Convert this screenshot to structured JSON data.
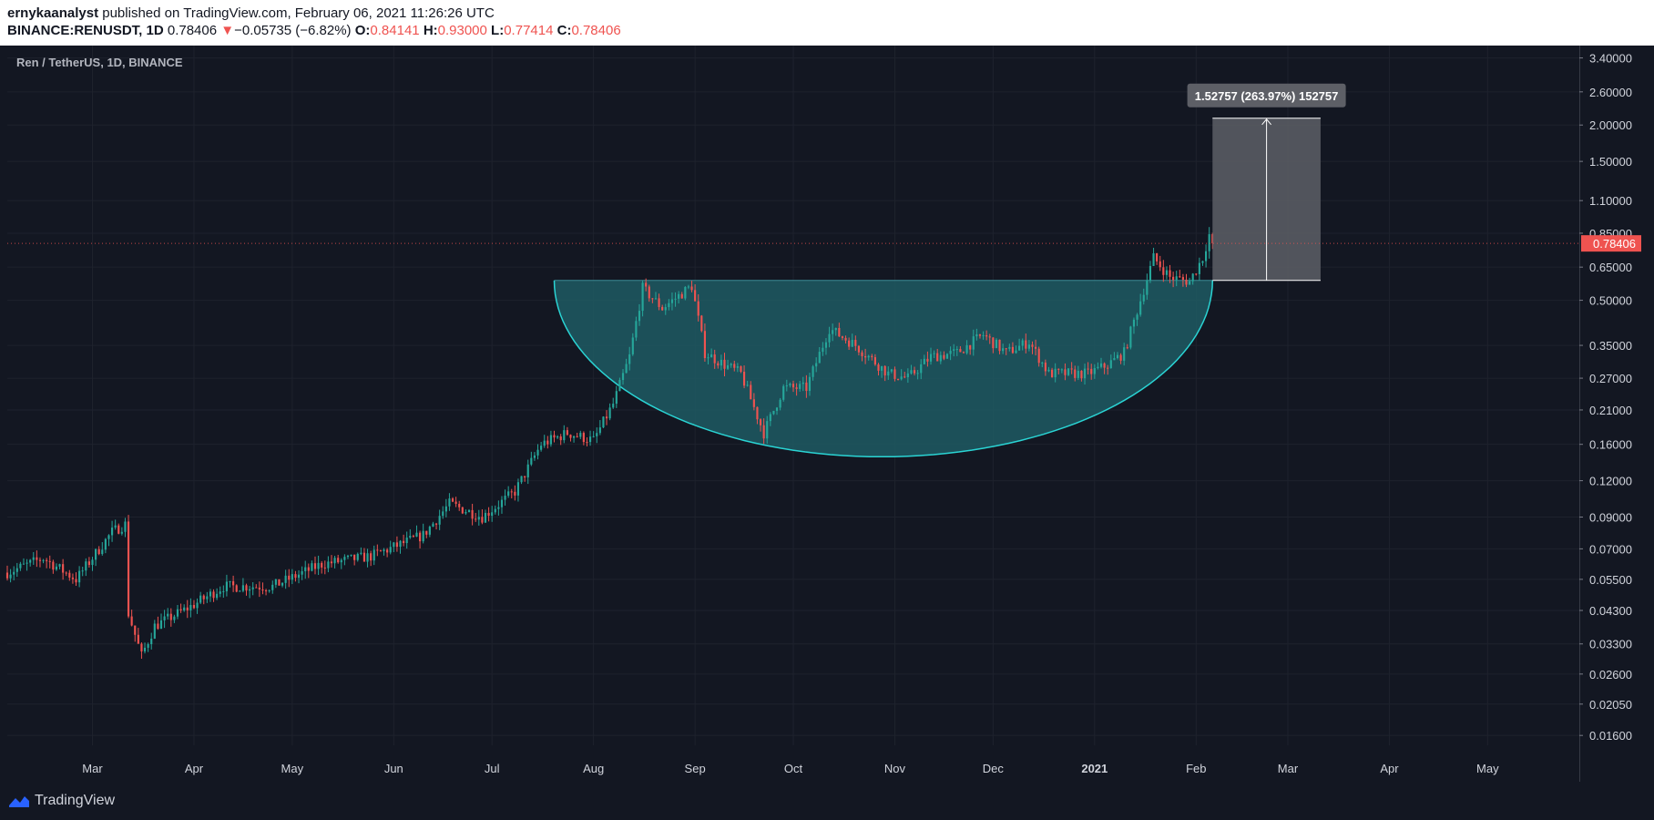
{
  "header": {
    "author": "ernykaanalyst",
    "published_text": "published on TradingView.com, February 06, 2021 11:26:26 UTC",
    "symbol": "BINANCE:RENUSDT, 1D",
    "price": "0.78406",
    "change_arrow": "▼",
    "change": "−0.05735 (−6.82%)",
    "o_label": "O:",
    "o_value": "0.84141",
    "h_label": "H:",
    "h_value": "0.93000",
    "l_label": "L:",
    "l_value": "0.77414",
    "c_label": "C:",
    "c_value": "0.78406"
  },
  "footer": {
    "brand": "TradingView",
    "brand_icon": "tradingview-logo-icon"
  },
  "colors": {
    "background": "#131722",
    "up": "#26a69a",
    "down": "#ef5350",
    "cup_fill": "#1e5a63",
    "cup_line": "#2ad4d4",
    "measure_fill": "#5d5f66",
    "grid": "#1e222d"
  },
  "chart_data": {
    "type": "candlestick",
    "title": "Ren / TetherUS, 1D, BINANCE",
    "scale": "log",
    "ylim": [
      0.0148,
      3.75
    ],
    "y_ticks": [
      "3.40000",
      "2.60000",
      "2.00000",
      "1.50000",
      "1.10000",
      "0.85000",
      "0.65000",
      "0.50000",
      "0.35000",
      "0.27000",
      "0.21000",
      "0.16000",
      "0.12000",
      "0.09000",
      "0.07000",
      "0.05500",
      "0.04300",
      "0.03300",
      "0.02600",
      "0.02050",
      "0.01600"
    ],
    "x_ticks": [
      {
        "label": "Mar",
        "date": "2020-03-01"
      },
      {
        "label": "Apr",
        "date": "2020-04-01"
      },
      {
        "label": "May",
        "date": "2020-05-01"
      },
      {
        "label": "Jun",
        "date": "2020-06-01"
      },
      {
        "label": "Jul",
        "date": "2020-07-01"
      },
      {
        "label": "Aug",
        "date": "2020-08-01"
      },
      {
        "label": "Sep",
        "date": "2020-09-01"
      },
      {
        "label": "Oct",
        "date": "2020-10-01"
      },
      {
        "label": "Nov",
        "date": "2020-11-01"
      },
      {
        "label": "Dec",
        "date": "2020-12-01"
      },
      {
        "label": "2021",
        "date": "2021-01-01",
        "bold": true
      },
      {
        "label": "Feb",
        "date": "2021-02-01"
      },
      {
        "label": "Mar",
        "date": "2021-03-01"
      },
      {
        "label": "Apr",
        "date": "2021-04-01"
      },
      {
        "label": "May",
        "date": "2021-05-01"
      }
    ],
    "xlim": [
      "2020-02-04",
      "2021-05-29"
    ],
    "last_price_label": "0.78406",
    "price_path": [
      [
        "2020-02-04",
        0.058
      ],
      [
        "2020-02-15",
        0.065
      ],
      [
        "2020-02-25",
        0.055
      ],
      [
        "2020-03-07",
        0.08
      ],
      [
        "2020-03-11",
        0.085
      ],
      [
        "2020-03-12",
        0.042
      ],
      [
        "2020-03-16",
        0.03
      ],
      [
        "2020-03-20",
        0.038
      ],
      [
        "2020-04-01",
        0.045
      ],
      [
        "2020-04-10",
        0.052
      ],
      [
        "2020-04-25",
        0.052
      ],
      [
        "2020-05-10",
        0.062
      ],
      [
        "2020-05-25",
        0.066
      ],
      [
        "2020-06-10",
        0.078
      ],
      [
        "2020-06-18",
        0.1
      ],
      [
        "2020-06-28",
        0.09
      ],
      [
        "2020-07-08",
        0.11
      ],
      [
        "2020-07-16",
        0.16
      ],
      [
        "2020-07-24",
        0.175
      ],
      [
        "2020-08-01",
        0.165
      ],
      [
        "2020-08-07",
        0.22
      ],
      [
        "2020-08-12",
        0.32
      ],
      [
        "2020-08-16",
        0.55
      ],
      [
        "2020-08-22",
        0.47
      ],
      [
        "2020-08-31",
        0.56
      ],
      [
        "2020-09-04",
        0.33
      ],
      [
        "2020-09-10",
        0.3
      ],
      [
        "2020-09-15",
        0.28
      ],
      [
        "2020-09-22",
        0.175
      ],
      [
        "2020-09-28",
        0.25
      ],
      [
        "2020-10-05",
        0.25
      ],
      [
        "2020-10-12",
        0.4
      ],
      [
        "2020-10-20",
        0.35
      ],
      [
        "2020-10-30",
        0.28
      ],
      [
        "2020-11-05",
        0.27
      ],
      [
        "2020-11-12",
        0.32
      ],
      [
        "2020-11-20",
        0.33
      ],
      [
        "2020-11-28",
        0.38
      ],
      [
        "2020-12-05",
        0.33
      ],
      [
        "2020-12-12",
        0.36
      ],
      [
        "2020-12-18",
        0.28
      ],
      [
        "2020-12-25",
        0.28
      ],
      [
        "2020-12-30",
        0.28
      ],
      [
        "2021-01-05",
        0.3
      ],
      [
        "2021-01-10",
        0.33
      ],
      [
        "2021-01-15",
        0.5
      ],
      [
        "2021-01-19",
        0.7
      ],
      [
        "2021-01-24",
        0.6
      ],
      [
        "2021-01-30",
        0.58
      ],
      [
        "2021-02-03",
        0.7
      ],
      [
        "2021-02-05",
        0.84
      ],
      [
        "2021-02-06",
        0.784
      ]
    ],
    "cup_pattern": {
      "left": {
        "date": "2020-07-20",
        "price": 0.585
      },
      "right": {
        "date": "2021-02-06",
        "price": 0.585
      },
      "bottom": {
        "date": "2020-10-28",
        "price": 0.145
      }
    },
    "measure": {
      "start_date": "2021-02-06",
      "end_date": "2021-03-11",
      "low": 0.585,
      "high": 2.11,
      "label": "1.52757 (263.97%) 152757"
    }
  }
}
